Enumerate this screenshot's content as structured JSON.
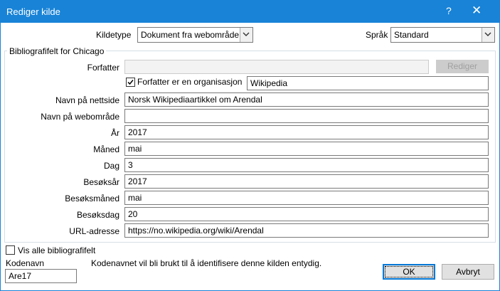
{
  "window": {
    "title": "Rediger kilde",
    "help_glyph": "?",
    "close_glyph": "✕"
  },
  "top": {
    "source_type_label": "Kildetype",
    "source_type_value": "Dokument fra webområde",
    "language_label": "Språk",
    "language_value": "Standard"
  },
  "group": {
    "title": "Bibliografifelt for Chicago"
  },
  "author": {
    "label": "Forfatter",
    "value": "",
    "edit_button": "Rediger",
    "org_checkbox_label": "Forfatter er en organisasjon",
    "org_checked": true,
    "org_value": "Wikipedia"
  },
  "fields": [
    {
      "label": "Navn på nettside",
      "value": "Norsk Wikipediaartikkel om Arendal"
    },
    {
      "label": "Navn på webområde",
      "value": ""
    },
    {
      "label": "År",
      "value": "2017"
    },
    {
      "label": "Måned",
      "value": "mai"
    },
    {
      "label": "Dag",
      "value": "3"
    },
    {
      "label": "Besøksår",
      "value": "2017"
    },
    {
      "label": "Besøksmåned",
      "value": "mai"
    },
    {
      "label": "Besøksdag",
      "value": "20"
    },
    {
      "label": "URL-adresse",
      "value": "https://no.wikipedia.org/wiki/Arendal"
    }
  ],
  "bottom": {
    "show_all_label": "Vis alle bibliografifelt",
    "show_all_checked": false,
    "tag_label": "Kodenavn",
    "tag_value": "Are17",
    "hint": "Kodenavnet vil bli brukt til å identifisere denne kilden entydig.",
    "ok_button": "OK",
    "cancel_button": "Avbryt"
  }
}
